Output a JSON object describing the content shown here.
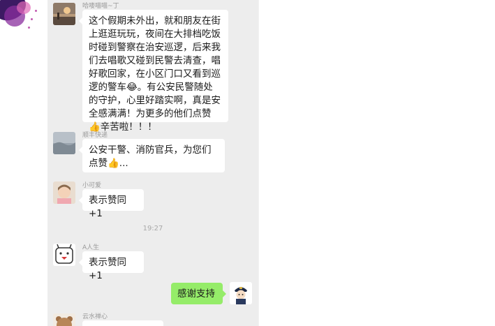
{
  "messages": [
    {
      "sender": "哈喽喵喵~丁",
      "text": "这个假期未外出，就和朋友在街上逛逛玩玩，夜间在大排档吃饭时碰到警察在治安巡逻，后来我们去唱歌又碰到民警去清查，唱好歌回家，在小区门口又看到巡逻的警车😂。有公安民警随处的守护，心里好踏实啊，真是安全感满满！为更多的他们点赞👍辛苦啦！！！"
    },
    {
      "sender": "顺丰快递",
      "text": "公安干警、消防官兵，为您们点赞👍..."
    },
    {
      "sender": "小可爱",
      "text": "表示赞同+1"
    },
    {
      "sender": "A人生",
      "text": "表示赞同+1"
    },
    {
      "sender": "",
      "text": "感谢支持"
    },
    {
      "sender": "云水禅心",
      "text": ""
    }
  ],
  "timestamp": "19:27",
  "icons": {
    "avatar_1": "sunset-avatar-icon",
    "avatar_2": "landscape-avatar-icon",
    "avatar_3": "child-avatar-icon",
    "avatar_4": "cartoon-face-avatar-icon",
    "avatar_me": "police-avatar-icon",
    "avatar_6": "bear-avatar-icon"
  },
  "colors": {
    "chat_background": "#ededed",
    "bubble_incoming": "#ffffff",
    "bubble_outgoing": "#95ec69"
  }
}
